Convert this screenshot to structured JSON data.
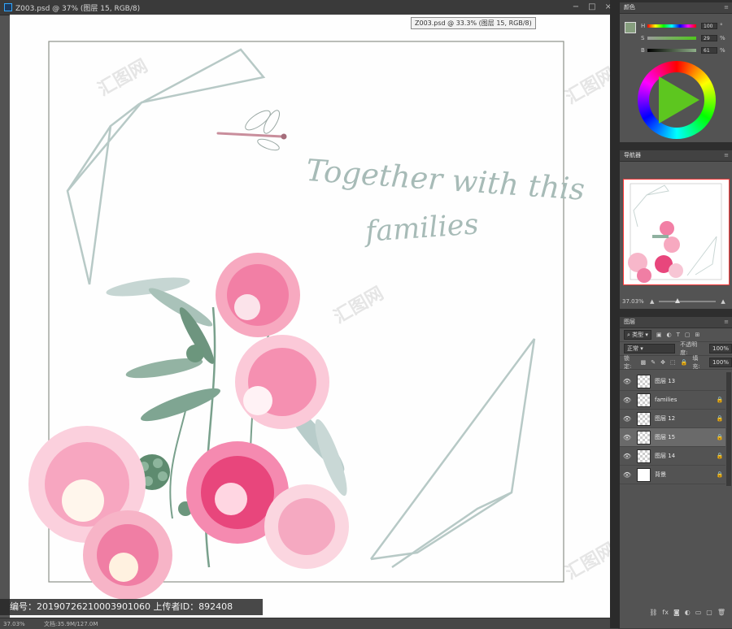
{
  "document": {
    "title": "Z003.psd @ 37% (图层 15, RGB/8)",
    "tooltip": "Z003.psd @ 33.3% (图层 15, RGB/8)",
    "window_controls": [
      "−",
      "□",
      "×"
    ]
  },
  "artwork": {
    "line1": "Together with this",
    "line2": "families",
    "watermark_text": "汇图网"
  },
  "source_bar": "编号：20190726210003901060 上传者ID：892408",
  "status": {
    "zoom": "37.03%",
    "doc_size": "文档:35.9M/127.0M"
  },
  "color_panel": {
    "tab": "颜色",
    "h_label": "H",
    "h_value": "100",
    "h_unit": "°",
    "s_label": "S",
    "s_value": "29",
    "s_unit": "%",
    "b_label": "B",
    "b_value": "61",
    "b_unit": "%",
    "hue": 100,
    "saturation": 29,
    "brightness": 61,
    "foreground_color": "#869e7e",
    "wheel_center_color": "#5dc61f"
  },
  "navigator": {
    "tab": "导航器",
    "zoom": "37.03%"
  },
  "layers": {
    "tab": "图层",
    "filter": "类型",
    "blend_mode": "正常",
    "opacity_label": "不透明度:",
    "opacity": "100%",
    "lock_label": "锁定:",
    "fill_label": "填充:",
    "fill": "100%",
    "items": [
      {
        "name": "图层 13",
        "eye": "👁",
        "lock": "",
        "solid": false,
        "selected": false
      },
      {
        "name": "families",
        "eye": "👁",
        "lock": "🔒",
        "solid": false,
        "selected": false
      },
      {
        "name": "图层 12",
        "eye": "👁",
        "lock": "🔒",
        "solid": false,
        "selected": false
      },
      {
        "name": "图层 15",
        "eye": "👁",
        "lock": "🔒",
        "solid": false,
        "selected": true
      },
      {
        "name": "图层 14",
        "eye": "👁",
        "lock": "🔒",
        "solid": false,
        "selected": false
      },
      {
        "name": "背景",
        "eye": "👁",
        "lock": "🔒",
        "solid": true,
        "selected": false
      }
    ],
    "bottom_icons": [
      "⛓",
      "fx",
      "◙",
      "◐",
      "▭",
      "▢",
      "🗑"
    ]
  },
  "colors": {
    "accent_blue": "#31a8ff",
    "frame_line": "#b7c9c6",
    "flower_pink": "#f27fa5",
    "leaf_green": "#6f9a82"
  }
}
